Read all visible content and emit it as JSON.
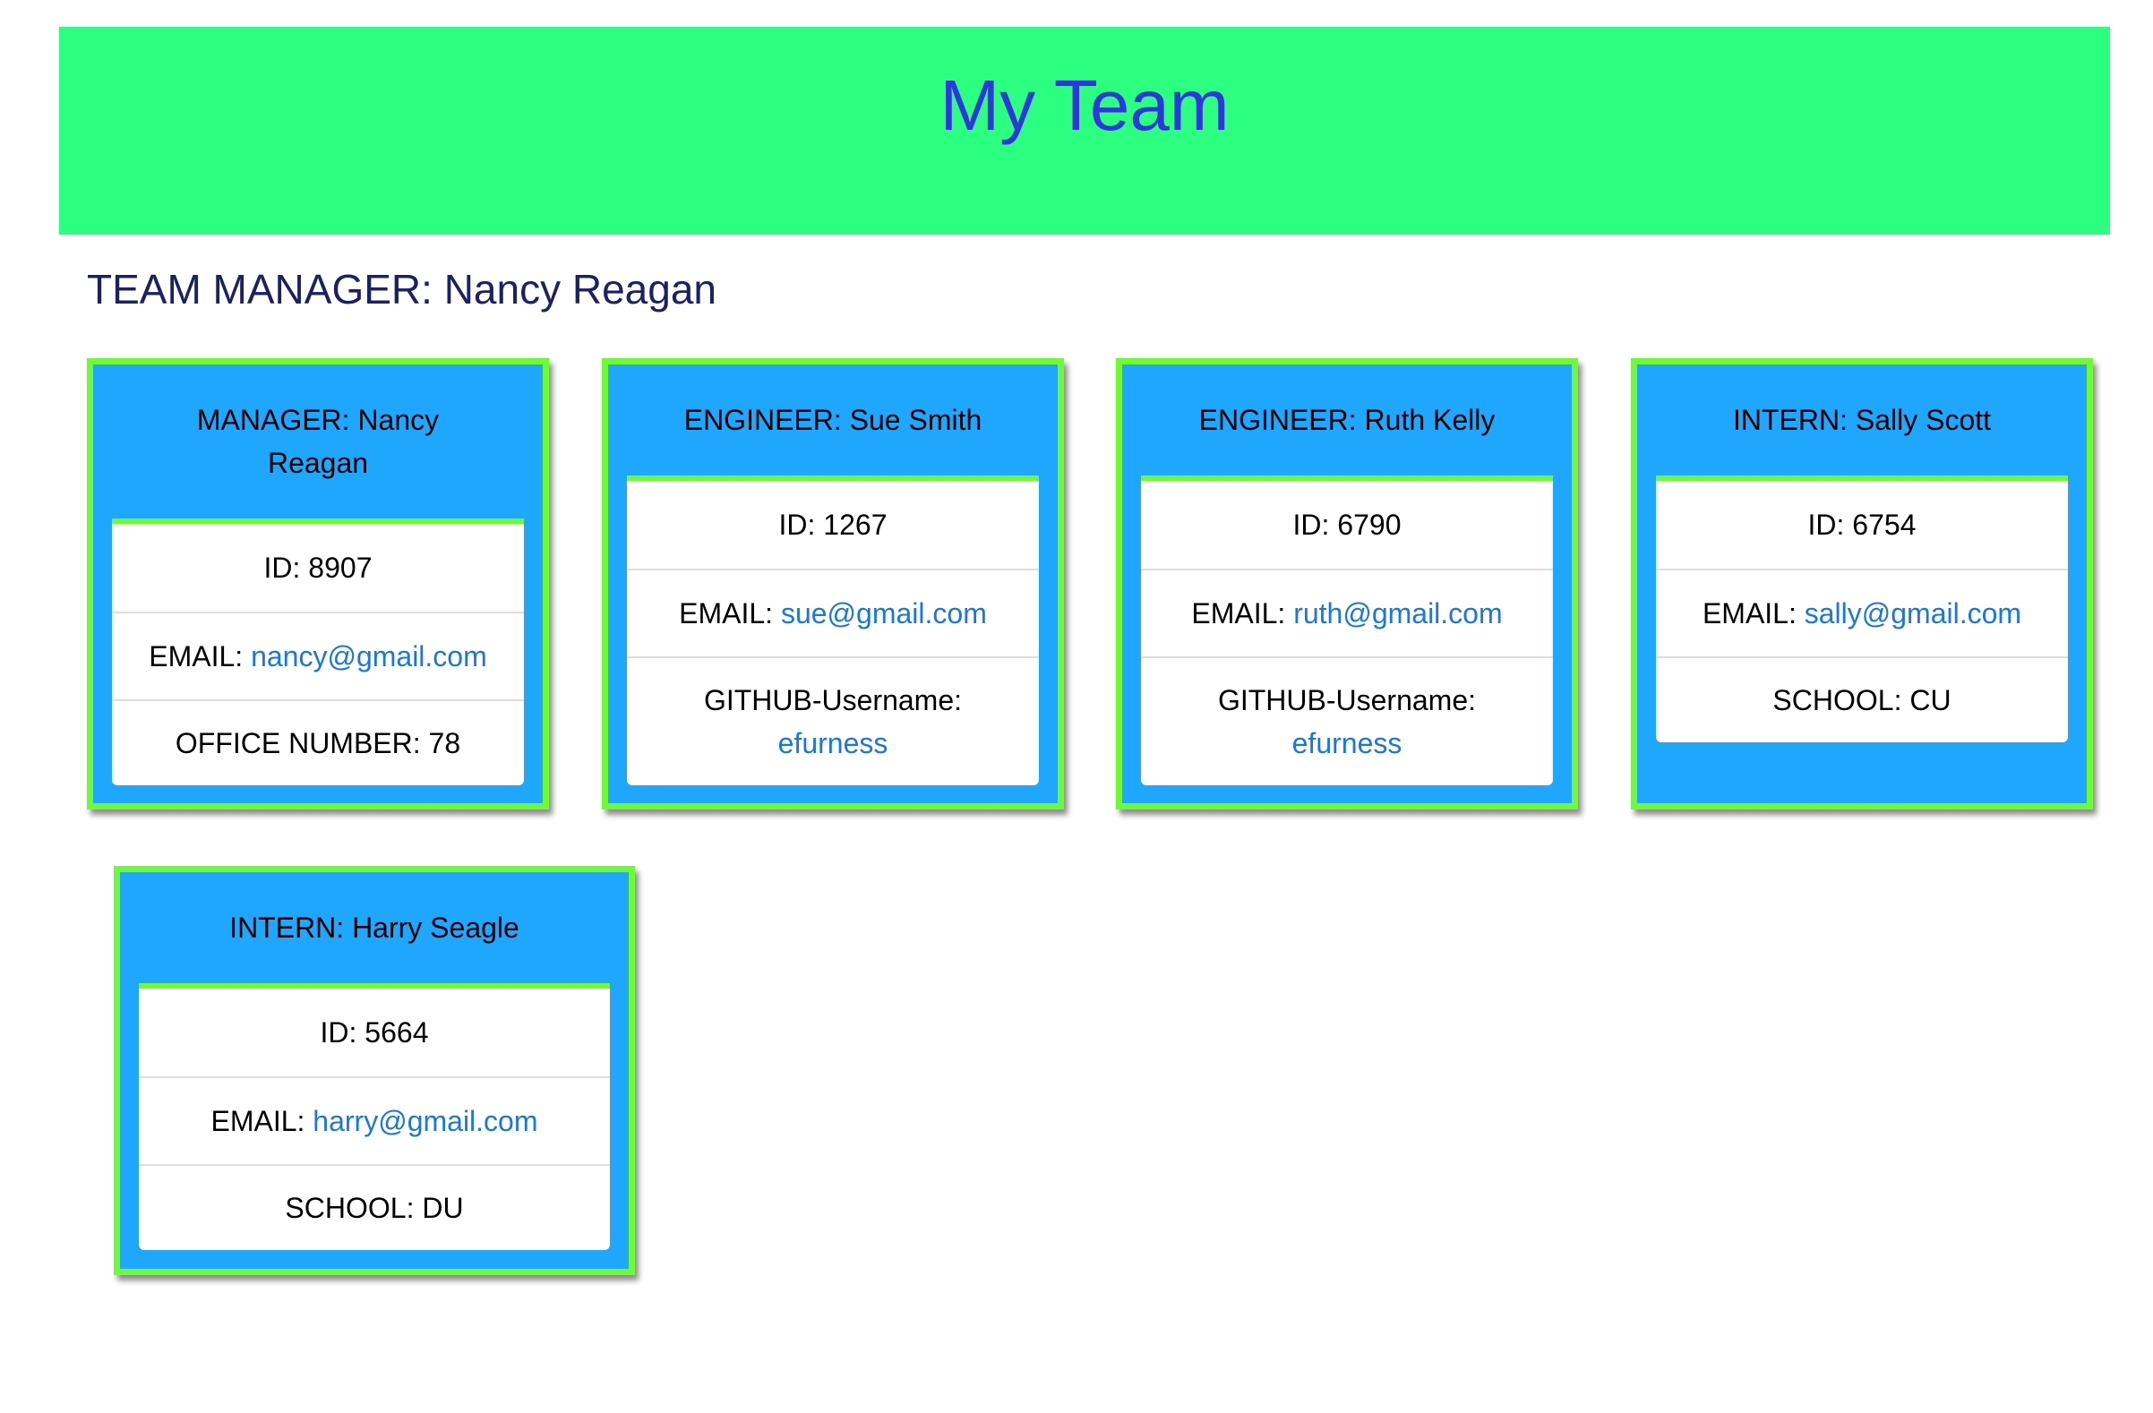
{
  "header": {
    "title": "My Team"
  },
  "manager_heading": "TEAM MANAGER: Nancy Reagan",
  "cards": [
    {
      "title": "MANAGER: Nancy Reagan",
      "id": "ID: 8907",
      "email_label": "EMAIL: ",
      "email": "nancy@gmail.com",
      "extra_label": "OFFICE NUMBER: 78"
    },
    {
      "title": "ENGINEER: Sue Smith",
      "id": "ID: 1267",
      "email_label": "EMAIL: ",
      "email": "sue@gmail.com",
      "extra_label": "GITHUB-Username:",
      "extra_link": "efurness"
    },
    {
      "title": "ENGINEER: Ruth Kelly",
      "id": "ID: 6790",
      "email_label": "EMAIL: ",
      "email": "ruth@gmail.com",
      "extra_label": "GITHUB-Username:",
      "extra_link": "efurness"
    },
    {
      "title": "INTERN: Sally Scott",
      "id": "ID: 6754",
      "email_label": "EMAIL: ",
      "email": "sally@gmail.com",
      "extra_label": "SCHOOL: CU"
    },
    {
      "title": "INTERN: Harry Seagle",
      "id": "ID: 5664",
      "email_label": "EMAIL: ",
      "email": "harry@gmail.com",
      "extra_label": "SCHOOL: DU"
    }
  ],
  "colors": {
    "header_bg": "#2cff7f",
    "title": "#2f36de",
    "card_bg": "#1ea7fd",
    "card_border": "#6dfb33",
    "link": "#1877e6"
  }
}
